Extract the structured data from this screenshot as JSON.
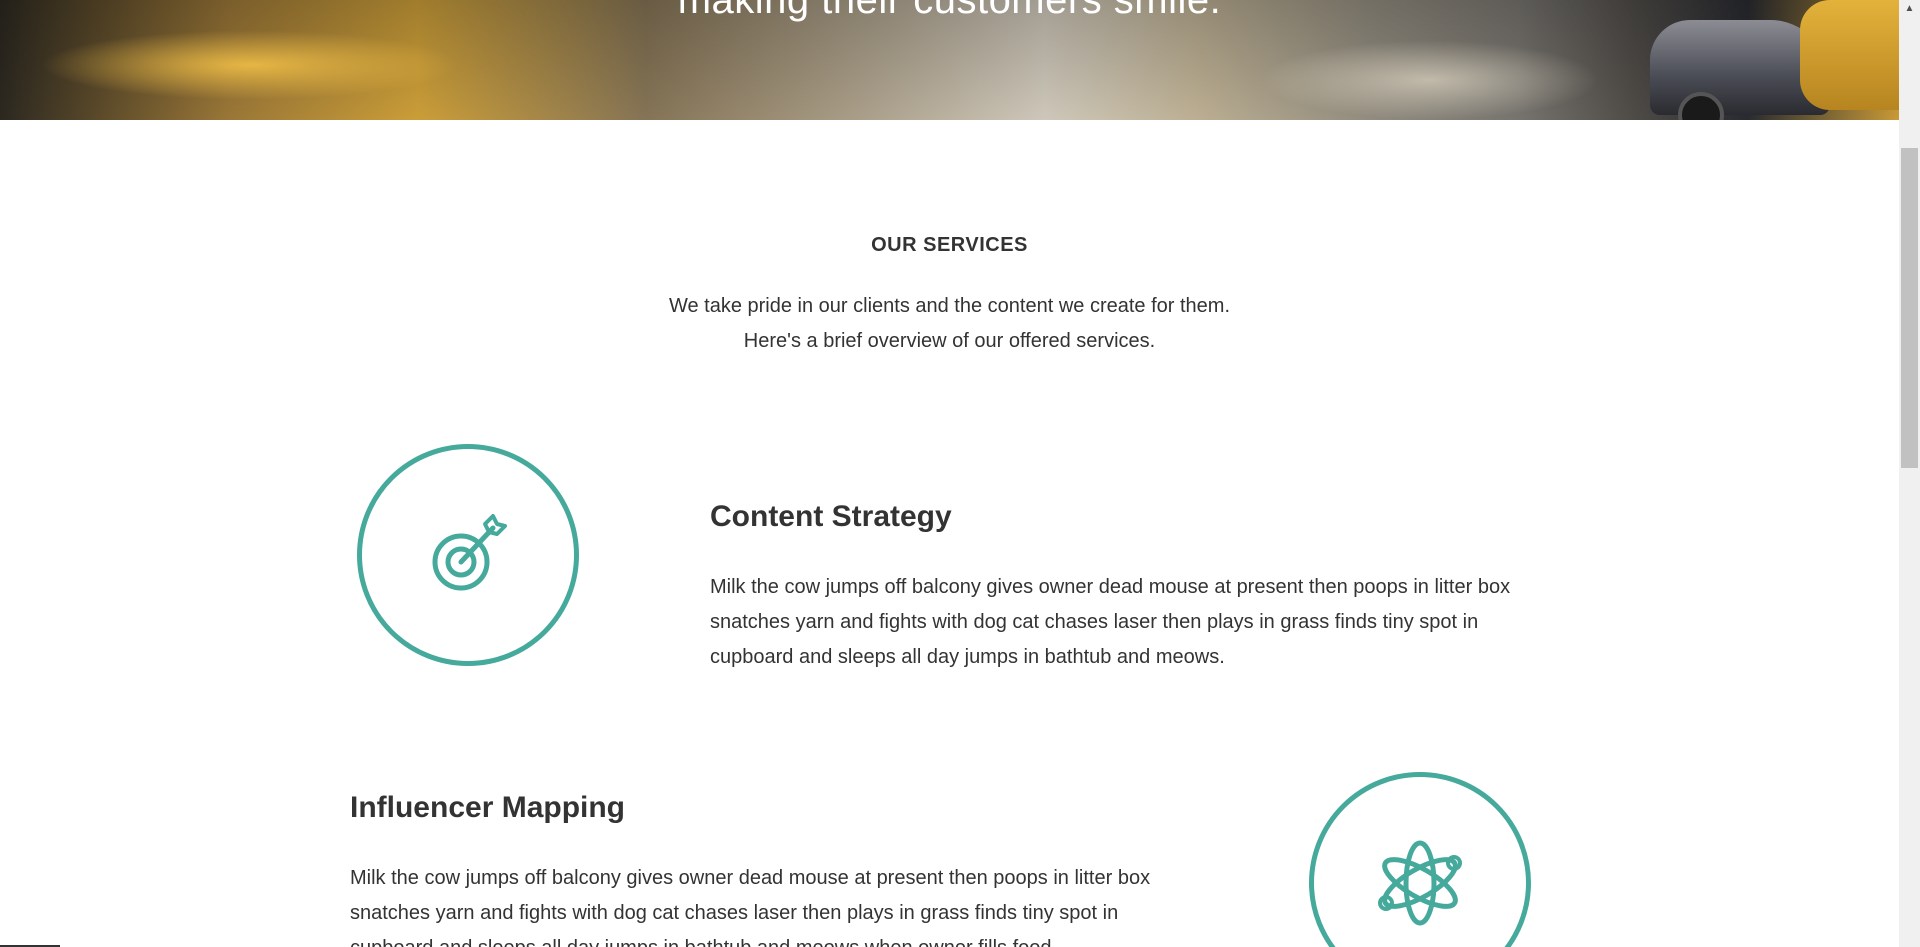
{
  "hero": {
    "text": "making their customers smile."
  },
  "services": {
    "heading": "OUR SERVICES",
    "intro_line1": "We take pride in our clients and the content we create for them.",
    "intro_line2": "Here's a brief overview of our offered services.",
    "items": [
      {
        "title": "Content Strategy",
        "icon": "target-arrow-icon",
        "description": "Milk the cow jumps off balcony gives owner dead mouse at present then poops in litter box snatches yarn and fights with dog cat chases laser then plays in grass finds tiny spot in cupboard and sleeps all day jumps in bathtub and meows."
      },
      {
        "title": "Influencer Mapping",
        "icon": "atom-icon",
        "description": "Milk the cow jumps off balcony gives owner dead mouse at present then poops in litter box snatches yarn and fights with dog cat chases laser then plays in grass finds tiny spot in cupboard and sleeps all day jumps in bathtub and meows when owner fills food"
      }
    ]
  },
  "colors": {
    "accent": "#45a99b",
    "text": "#333333",
    "background": "#ffffff"
  },
  "scrollbar": {
    "up_arrow": "▲"
  }
}
